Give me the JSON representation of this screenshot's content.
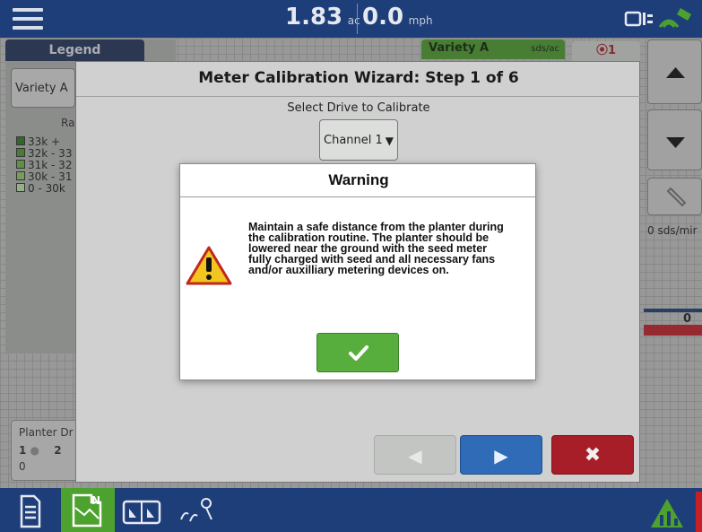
{
  "topbar": {
    "area_value": "1.83",
    "area_unit": "ac",
    "speed_value": "0.0",
    "speed_unit": "mph"
  },
  "legend": {
    "header": "Legend",
    "variety_button": "Variety A",
    "range_label": "Ra",
    "items": [
      {
        "label": "33k +",
        "color": "#2e7d1e"
      },
      {
        "label": "32k - 33",
        "color": "#4da12e"
      },
      {
        "label": "31k - 32",
        "color": "#6fbf4a"
      },
      {
        "label": "30k - 31",
        "color": "#94d36e"
      },
      {
        "label": "0 - 30k",
        "color": "#c8eeb6"
      }
    ]
  },
  "planter": {
    "title": "Planter Dr",
    "row1": "1",
    "row2": "2",
    "value": "0"
  },
  "variety_tab": {
    "label": "Variety A",
    "units": "sds/ac"
  },
  "alert_tab": {
    "label": "⦿1"
  },
  "right_panel": {
    "rate": "0 sds/mir",
    "percent": "0 %"
  },
  "wizard": {
    "title": "Meter Calibration Wizard:  Step 1 of 6",
    "drive_label": "Select Drive to Calibrate",
    "channel_value": "Channel 1"
  },
  "warning": {
    "title": "Warning",
    "message": "Maintain a safe distance from the planter during the calibration routine. The planter should be lowered near the ground with the seed meter fully charged with seed and all necessary fans and/or auxilliary metering  devices on."
  },
  "colors": {
    "topbar": "#1e3e7a",
    "accent_green": "#58ae3d",
    "next_blue": "#2f6bb6",
    "cancel_red": "#a81e28"
  }
}
